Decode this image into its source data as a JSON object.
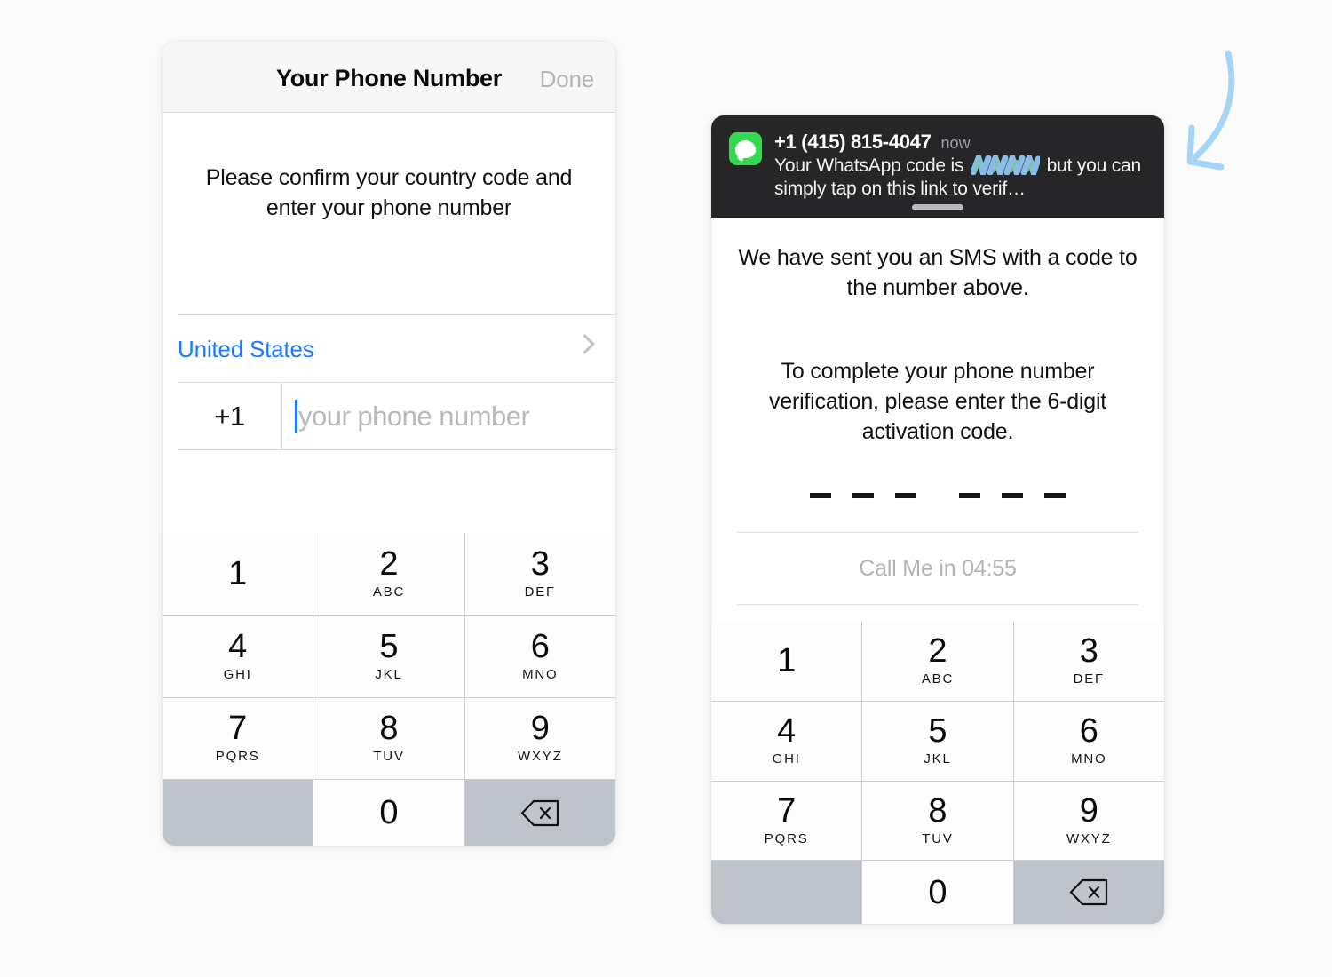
{
  "background_color": "#fbfbfb",
  "accent_color": "#1a7bff",
  "phone_left": {
    "nav": {
      "title": "Your Phone Number",
      "done_label": "Done",
      "done_color": "#b4b4b4"
    },
    "instructions": "Please confirm your country code and enter your phone number",
    "country_row": {
      "country": "United States",
      "chevron_icon": "chevron-right-icon"
    },
    "number_row": {
      "country_code": "+1",
      "placeholder": "your phone number",
      "value": ""
    },
    "keypad": {
      "keys": [
        {
          "digit": "1",
          "letters": ""
        },
        {
          "digit": "2",
          "letters": "ABC"
        },
        {
          "digit": "3",
          "letters": "DEF"
        },
        {
          "digit": "4",
          "letters": "GHI"
        },
        {
          "digit": "5",
          "letters": "JKL"
        },
        {
          "digit": "6",
          "letters": "MNO"
        },
        {
          "digit": "7",
          "letters": "PQRS"
        },
        {
          "digit": "8",
          "letters": "TUV"
        },
        {
          "digit": "9",
          "letters": "WXYZ"
        },
        {
          "digit": "0",
          "letters": ""
        }
      ],
      "blank_key": "",
      "delete_icon": "backspace-delete-icon",
      "key_bg": "#fdfdfd",
      "special_key_bg": "#bfc3cb"
    }
  },
  "phone_right": {
    "notification": {
      "app_icon": "messages-app-icon",
      "app_icon_color": "#33da4e",
      "sender": "+1 (415) 815-4047",
      "time": "now",
      "body_before": "Your WhatsApp code is",
      "redacted": "redacted-scribble",
      "body_after": "but you can simply tap on this link to verif…",
      "grabber": "notification-grabber",
      "background_color": "#262628"
    },
    "instructions_1": "We have sent you an SMS with a code to the number above.",
    "instructions_2": "To complete your phone number verification, please enter the 6-digit activation code.",
    "code_entry": {
      "length": 6,
      "value": "",
      "dashes": [
        "-",
        "-",
        "-",
        "-",
        "-",
        "-"
      ]
    },
    "call_me": "Call Me in 04:55",
    "keypad": {
      "keys": [
        {
          "digit": "1",
          "letters": ""
        },
        {
          "digit": "2",
          "letters": "ABC"
        },
        {
          "digit": "3",
          "letters": "DEF"
        },
        {
          "digit": "4",
          "letters": "GHI"
        },
        {
          "digit": "5",
          "letters": "JKL"
        },
        {
          "digit": "6",
          "letters": "MNO"
        },
        {
          "digit": "7",
          "letters": "PQRS"
        },
        {
          "digit": "8",
          "letters": "TUV"
        },
        {
          "digit": "9",
          "letters": "WXYZ"
        },
        {
          "digit": "0",
          "letters": ""
        }
      ],
      "blank_key": "",
      "delete_icon": "backspace-delete-icon"
    }
  },
  "annotation": {
    "arrow_icon": "curved-arrow-down-left-icon",
    "color": "#a6d4f7"
  }
}
